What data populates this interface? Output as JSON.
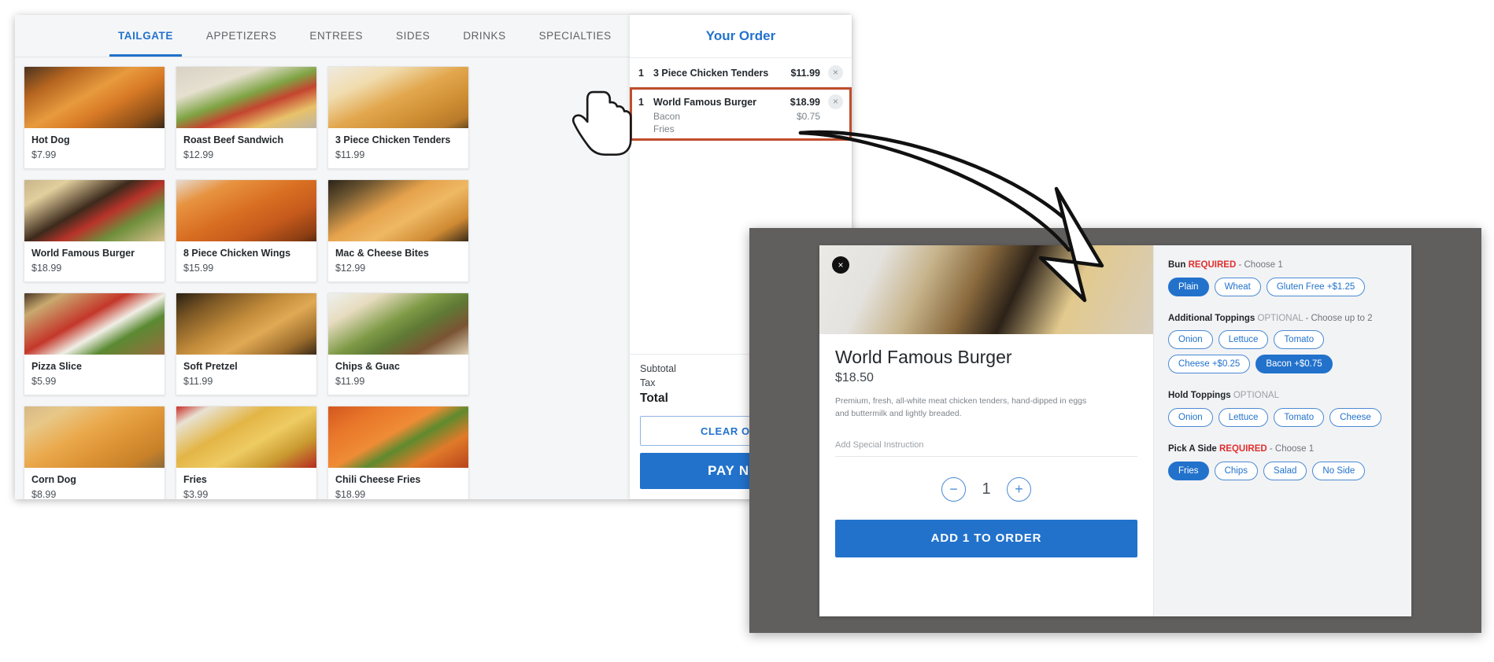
{
  "tabs": [
    {
      "label": "TAILGATE",
      "active": true
    },
    {
      "label": "APPETIZERS",
      "active": false
    },
    {
      "label": "ENTREES",
      "active": false
    },
    {
      "label": "SIDES",
      "active": false
    },
    {
      "label": "DRINKS",
      "active": false
    },
    {
      "label": "SPECIALTIES",
      "active": false
    }
  ],
  "menu_items": [
    {
      "name": "Hot Dog",
      "price": "$7.99",
      "img": "hotdog"
    },
    {
      "name": "Roast Beef Sandwich",
      "price": "$12.99",
      "img": "roastbeef"
    },
    {
      "name": "3 Piece Chicken Tenders",
      "price": "$11.99",
      "img": "tenders"
    },
    {
      "name": "World Famous Burger",
      "price": "$18.99",
      "img": "burger"
    },
    {
      "name": "8 Piece Chicken Wings",
      "price": "$15.99",
      "img": "wings"
    },
    {
      "name": "Mac & Cheese Bites",
      "price": "$12.99",
      "img": "macbites"
    },
    {
      "name": "Pizza Slice",
      "price": "$5.99",
      "img": "pizza"
    },
    {
      "name": "Soft Pretzel",
      "price": "$11.99",
      "img": "pretzel"
    },
    {
      "name": "Chips & Guac",
      "price": "$11.99",
      "img": "guac"
    },
    {
      "name": "Corn Dog",
      "price": "$8.99",
      "img": "corndog"
    },
    {
      "name": "Fries",
      "price": "$3.99",
      "img": "fries"
    },
    {
      "name": "Chili Cheese Fries",
      "price": "$18.99",
      "img": "chilifries"
    },
    {
      "name": "",
      "price": "",
      "img": "nachos"
    },
    {
      "name": "",
      "price": "",
      "img": "mojito"
    }
  ],
  "order": {
    "title": "Your Order",
    "items": [
      {
        "qty": "1",
        "name": "3 Piece Chicken Tenders",
        "price": "$11.99",
        "remove_icon": "×",
        "selected": false,
        "mods": []
      },
      {
        "qty": "1",
        "name": "World Famous Burger",
        "price": "$18.99",
        "remove_icon": "×",
        "selected": true,
        "mods": [
          {
            "name": "Bacon",
            "price": "$0.75"
          },
          {
            "name": "Fries",
            "price": ""
          }
        ]
      }
    ],
    "totals": [
      {
        "label": "Subtotal",
        "value": ""
      },
      {
        "label": "Tax",
        "value": ""
      }
    ],
    "total_label": "Total",
    "total_value": "",
    "clear_label": "CLEAR ORDER",
    "pay_label": "PAY NOW",
    "accent_color": "#2272cc",
    "highlight_color": "#bf4e2b"
  },
  "modal": {
    "close_icon": "×",
    "title": "World Famous Burger",
    "price": "$18.50",
    "description": "Premium, fresh, all-white meat chicken tenders, hand-dipped in eggs and buttermilk and lightly breaded.",
    "special_instruction_placeholder": "Add Special Instruction",
    "qty_minus": "−",
    "qty_value": "1",
    "qty_plus": "+",
    "add_label": "ADD 1 TO ORDER",
    "option_groups": [
      {
        "name": "Bun",
        "requirement": "REQUIRED",
        "requirement_type": "required",
        "hint": "- Choose 1",
        "options": [
          {
            "label": "Plain",
            "selected": true
          },
          {
            "label": "Wheat",
            "selected": false
          },
          {
            "label": "Gluten Free  +$1.25",
            "selected": false
          }
        ]
      },
      {
        "name": "Additional Toppings",
        "requirement": "OPTIONAL",
        "requirement_type": "optional",
        "hint": "- Choose up to 2",
        "options": [
          {
            "label": "Onion",
            "selected": false
          },
          {
            "label": "Lettuce",
            "selected": false
          },
          {
            "label": "Tomato",
            "selected": false
          },
          {
            "label": "Cheese  +$0.25",
            "selected": false
          },
          {
            "label": "Bacon  +$0.75",
            "selected": true
          }
        ]
      },
      {
        "name": "Hold Toppings",
        "requirement": "OPTIONAL",
        "requirement_type": "optional",
        "hint": "",
        "options": [
          {
            "label": "Onion",
            "selected": false
          },
          {
            "label": "Lettuce",
            "selected": false
          },
          {
            "label": "Tomato",
            "selected": false
          },
          {
            "label": "Cheese",
            "selected": false
          }
        ]
      },
      {
        "name": "Pick A Side",
        "requirement": "REQUIRED",
        "requirement_type": "required",
        "hint": "- Choose 1",
        "options": [
          {
            "label": "Fries",
            "selected": true
          },
          {
            "label": "Chips",
            "selected": false
          },
          {
            "label": "Salad",
            "selected": false
          },
          {
            "label": "No Side",
            "selected": false
          }
        ]
      }
    ]
  },
  "annotations": {
    "cursor_icon": "pointing-hand-cursor",
    "arrow_icon": "curved-callout-arrow",
    "highlight_box_color": "#bf4e2b"
  }
}
